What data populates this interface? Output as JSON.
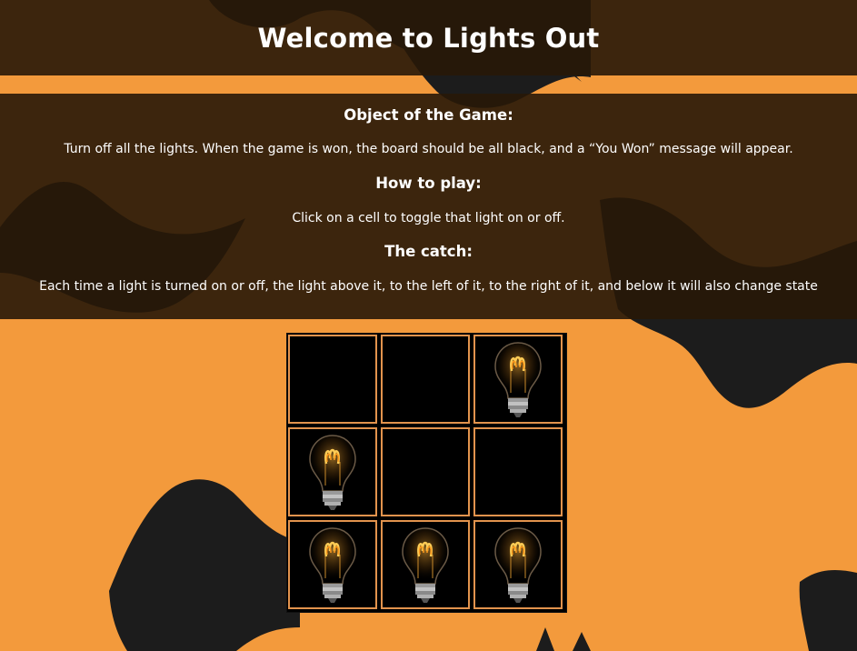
{
  "header": {
    "title": "Welcome to Lights Out"
  },
  "instructions": {
    "object_heading": "Object of the Game:",
    "object_text": "Turn off all the lights. When the game is won, the board should be all black, and a “You Won” message will appear.",
    "howto_heading": "How to play:",
    "howto_text": "Click on a cell to toggle that light on or off.",
    "catch_heading": "The catch:",
    "catch_text": "Each time a light is turned on or off, the light above it, to the left of it, to the right of it, and below it will also change state"
  },
  "board": {
    "rows": 3,
    "cols": 3,
    "lit": [
      [
        false,
        false,
        true
      ],
      [
        true,
        false,
        false
      ],
      [
        true,
        true,
        true
      ]
    ],
    "lit_icon": "lightbulb-icon"
  },
  "colors": {
    "background": "#f39a3c",
    "panel": "#281808",
    "cell_border": "#e2934d",
    "cell_off": "#000000"
  }
}
